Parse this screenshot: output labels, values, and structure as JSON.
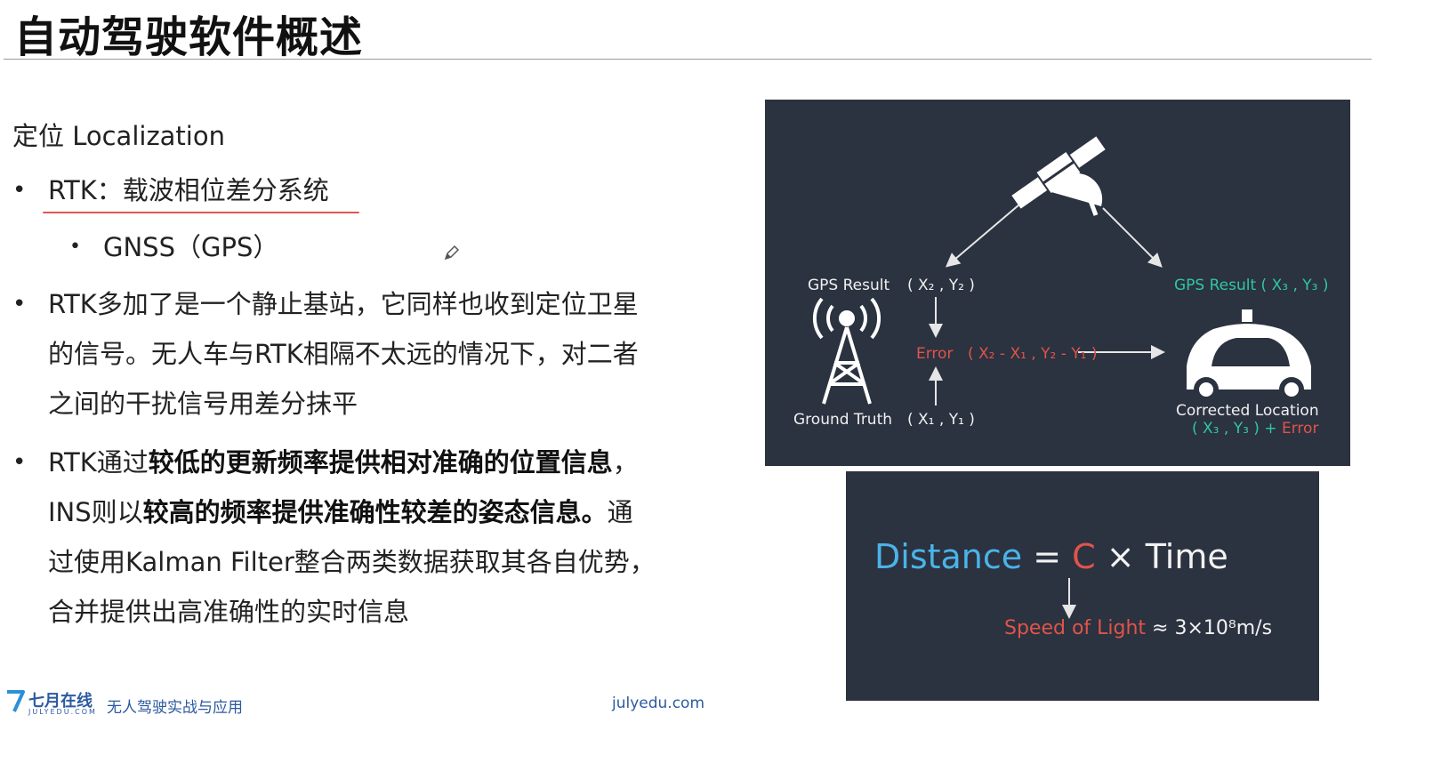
{
  "slide": {
    "title": "自动驾驶软件概述"
  },
  "content": {
    "section_heading": "定位 Localization",
    "bullet1": "RTK：载波相位差分系统",
    "sub_bullet": "GNSS（GPS）",
    "bullet2_line1": "RTK多加了是一个静止基站，它同样也收到定位卫星",
    "bullet2_line2": "的信号。无人车与RTK相隔不太远的情况下，对二者",
    "bullet2_line3": "之间的干扰信号用差分抹平",
    "bullet3_line1_a": "RTK通过",
    "bullet3_line1_b": "较低的更新频率提供相对准确的位置信息",
    "bullet3_line1_c": "，",
    "bullet3_line2_a": "INS则以",
    "bullet3_line2_b": "较高的频率提供准确性较差的姿态信息。",
    "bullet3_line2_c": "通",
    "bullet3_line3": "过使用Kalman Filter整合两类数据获取其各自优势，",
    "bullet3_line4": "合并提供出高准确性的实时信息"
  },
  "footer": {
    "brand": "七月在线",
    "brand_sub": "JULYEDU.COM",
    "course": "无人驾驶实战与应用",
    "url": "julyedu.com"
  },
  "gps_diagram": {
    "left_result": "GPS Result",
    "left_result_coord": "( X₂ , Y₂ )",
    "error_label": "Error",
    "error_expr": "( X₂ - X₁ , Y₂ - Y₁ )",
    "ground_truth": "Ground Truth",
    "ground_truth_coord": "( X₁ , Y₁ )",
    "right_result": "GPS Result ( X₃ , Y₃ )",
    "corrected": "Corrected Location",
    "corrected_coord": "( X₃ , Y₃ ) +",
    "corrected_error": "Error"
  },
  "distance_diagram": {
    "distance": "Distance",
    "equals": " = ",
    "c": "C",
    "times_time": " × Time",
    "speed_label": "Speed of Light",
    "speed_value": " ≈ 3×10⁸m/s"
  }
}
